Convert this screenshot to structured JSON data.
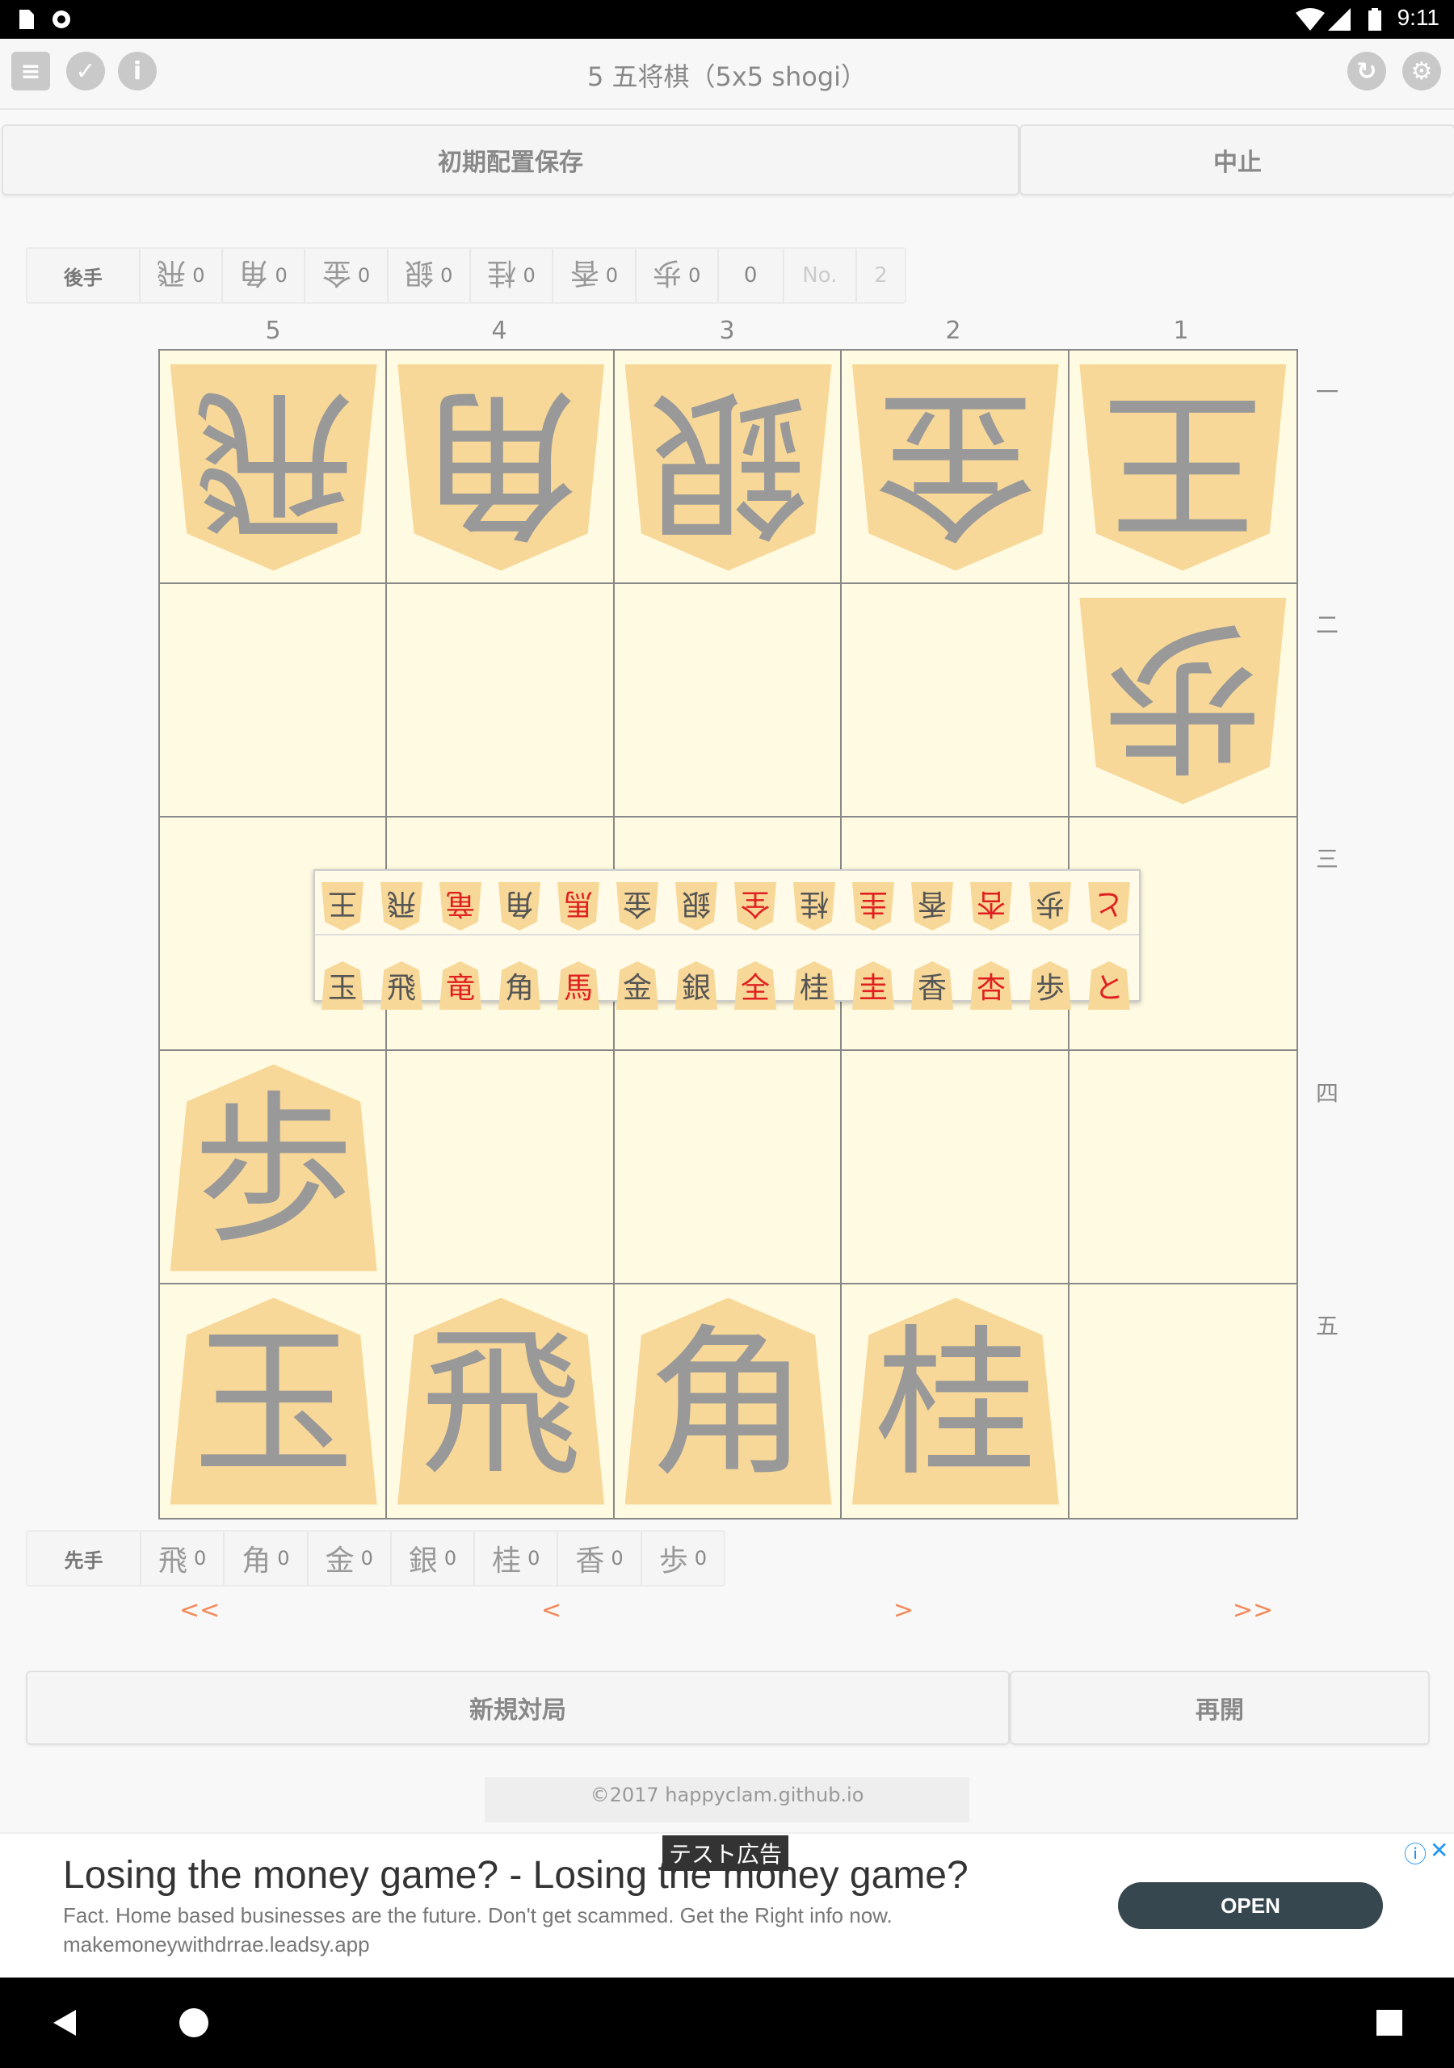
{
  "status": {
    "time": "9:11"
  },
  "app": {
    "title": "5 五将棋（5x5 shogi）"
  },
  "top_buttons": {
    "save_initial": "初期配置保存",
    "cancel": "中止"
  },
  "gote_hand": {
    "label": "後手",
    "pieces": [
      {
        "kanji": "飛",
        "count": "0"
      },
      {
        "kanji": "角",
        "count": "0"
      },
      {
        "kanji": "金",
        "count": "0"
      },
      {
        "kanji": "銀",
        "count": "0"
      },
      {
        "kanji": "桂",
        "count": "0"
      },
      {
        "kanji": "香",
        "count": "0"
      },
      {
        "kanji": "歩",
        "count": "0"
      }
    ],
    "extra_count": "0",
    "no_label": "No.",
    "no_value": "2"
  },
  "board": {
    "columns": [
      "5",
      "4",
      "3",
      "2",
      "1"
    ],
    "rows": [
      "一",
      "二",
      "三",
      "四",
      "五"
    ],
    "pieces": [
      {
        "col": 0,
        "row": 0,
        "kanji": "飛",
        "owner": "gote"
      },
      {
        "col": 1,
        "row": 0,
        "kanji": "角",
        "owner": "gote"
      },
      {
        "col": 2,
        "row": 0,
        "kanji": "銀",
        "owner": "gote"
      },
      {
        "col": 3,
        "row": 0,
        "kanji": "金",
        "owner": "gote"
      },
      {
        "col": 4,
        "row": 0,
        "kanji": "王",
        "owner": "gote"
      },
      {
        "col": 4,
        "row": 1,
        "kanji": "歩",
        "owner": "gote"
      },
      {
        "col": 0,
        "row": 3,
        "kanji": "歩",
        "owner": "sente"
      },
      {
        "col": 0,
        "row": 4,
        "kanji": "玉",
        "owner": "sente"
      },
      {
        "col": 1,
        "row": 4,
        "kanji": "飛",
        "owner": "sente"
      },
      {
        "col": 2,
        "row": 4,
        "kanji": "角",
        "owner": "sente"
      },
      {
        "col": 3,
        "row": 4,
        "kanji": "桂",
        "owner": "sente"
      }
    ]
  },
  "palette": {
    "gote": [
      {
        "k": "王",
        "c": "#555555"
      },
      {
        "k": "飛",
        "c": "#555555"
      },
      {
        "k": "竜",
        "c": "#e02020"
      },
      {
        "k": "角",
        "c": "#555555"
      },
      {
        "k": "馬",
        "c": "#e02020"
      },
      {
        "k": "金",
        "c": "#555555"
      },
      {
        "k": "銀",
        "c": "#555555"
      },
      {
        "k": "全",
        "c": "#e02020"
      },
      {
        "k": "桂",
        "c": "#555555"
      },
      {
        "k": "圭",
        "c": "#e02020"
      },
      {
        "k": "香",
        "c": "#555555"
      },
      {
        "k": "杏",
        "c": "#e02020"
      },
      {
        "k": "歩",
        "c": "#555555"
      },
      {
        "k": "と",
        "c": "#e02020"
      }
    ],
    "sente": [
      {
        "k": "玉",
        "c": "#555555"
      },
      {
        "k": "飛",
        "c": "#555555"
      },
      {
        "k": "竜",
        "c": "#e02020"
      },
      {
        "k": "角",
        "c": "#555555"
      },
      {
        "k": "馬",
        "c": "#e02020"
      },
      {
        "k": "金",
        "c": "#555555"
      },
      {
        "k": "銀",
        "c": "#555555"
      },
      {
        "k": "全",
        "c": "#e02020"
      },
      {
        "k": "桂",
        "c": "#555555"
      },
      {
        "k": "圭",
        "c": "#e02020"
      },
      {
        "k": "香",
        "c": "#555555"
      },
      {
        "k": "杏",
        "c": "#e02020"
      },
      {
        "k": "歩",
        "c": "#555555"
      },
      {
        "k": "と",
        "c": "#e02020"
      }
    ]
  },
  "sente_hand": {
    "label": "先手",
    "pieces": [
      {
        "kanji": "飛",
        "count": "0"
      },
      {
        "kanji": "角",
        "count": "0"
      },
      {
        "kanji": "金",
        "count": "0"
      },
      {
        "kanji": "銀",
        "count": "0"
      },
      {
        "kanji": "桂",
        "count": "0"
      },
      {
        "kanji": "香",
        "count": "0"
      },
      {
        "kanji": "歩",
        "count": "0"
      }
    ]
  },
  "nav": {
    "first": "<<",
    "prev": "<",
    "next": ">",
    "last": ">>"
  },
  "bottom_buttons": {
    "new_game": "新規対局",
    "resume": "再開"
  },
  "footer": {
    "copyright": "©2017 happyclam.github.io"
  },
  "ad": {
    "tag": "テスト広告",
    "headline": "Losing the money game? - Losing the money game?",
    "body": "Fact. Home based businesses are the future. Don't get scammed. Get the Right info now.",
    "url": "makemoneywithdrrae.leadsy.app",
    "cta": "OPEN"
  }
}
